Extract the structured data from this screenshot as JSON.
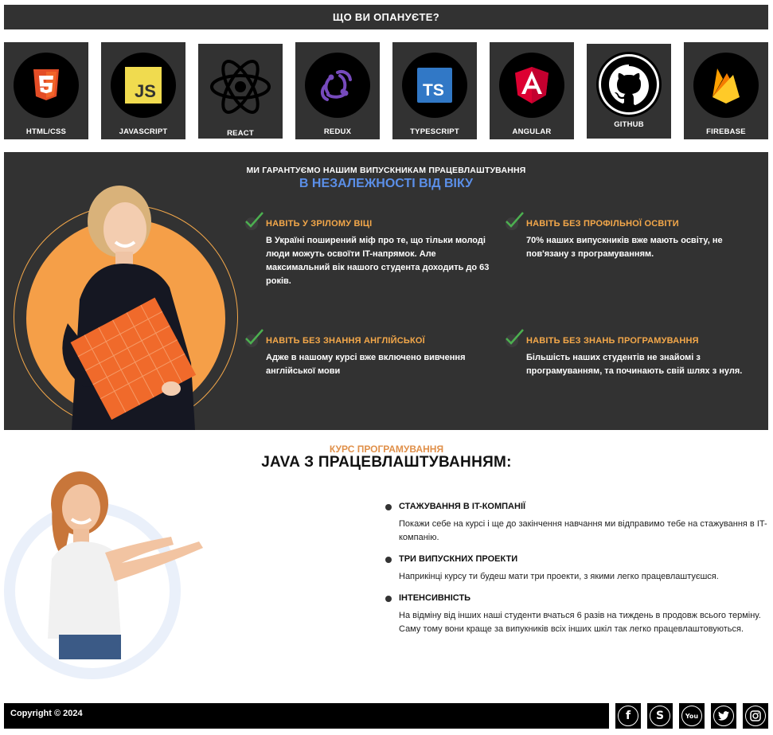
{
  "header": {
    "title": "ЩО ВИ ОПАНУЄТЕ?"
  },
  "technologies": [
    {
      "label": "HTML/CSS",
      "icon": "html5-icon"
    },
    {
      "label": "JAVASCRIPT",
      "icon": "javascript-icon"
    },
    {
      "label": "REACT",
      "icon": "react-icon"
    },
    {
      "label": "REDUX",
      "icon": "redux-icon"
    },
    {
      "label": "TYPESCRIPT",
      "icon": "typescript-icon"
    },
    {
      "label": "ANGULAR",
      "icon": "angular-icon"
    },
    {
      "label": "GITHUB",
      "icon": "github-icon"
    },
    {
      "label": "FIREBASE",
      "icon": "firebase-icon"
    }
  ],
  "guarantee": {
    "title": "МИ ГАРАНТУЄМО НАШИМ ВИПУСКНИКАМ ПРАЦЕВЛАШТУВАННЯ",
    "accent": "В НЕЗАЛЕЖНОСТІ ВІД ВІКУ",
    "features": [
      {
        "title": "НАВІТЬ У ЗРІЛОМУ ВІЦІ",
        "text": "В Україні поширений міф про те, що тільки молоді люди можуть освоїти IT-напрямок. Але максимальний вік нашого студента доходить до 63 років."
      },
      {
        "title": "НАВІТЬ БЕЗ ПРОФІЛЬНОЇ ОСВІТИ",
        "text": "70% наших випускників вже мають освіту, не пов'язану з програмуванням."
      },
      {
        "title": "НАВІТЬ БЕЗ ЗНАННЯ АНГЛІЙСЬКОЇ",
        "text": "Адже в нашому курсі вже включено вивчення англійської мови"
      },
      {
        "title": "НАВІТЬ БЕЗ ЗНАНЬ ПРОГРАМУВАННЯ",
        "text": "Більшість наших студентів не знайомі з програмуванням, та починають свій шлях з нуля."
      }
    ]
  },
  "course": {
    "subtitle": "КУРС ПРОГРАМУВАННЯ",
    "title": "JAVA З ПРАЦЕВЛАШТУВАННЯМ:",
    "items": [
      {
        "title": "СТАЖУВАННЯ В IT-КОМПАНІЇ",
        "text": "Покажи себе на курсі і ще до закінчення навчання ми відправимо тебе на стажування в IT-компанію."
      },
      {
        "title": "ТРИ ВИПУСКНИХ ПРОЕКТИ",
        "text": "Наприкінці курсу ти будеш мати три проекти, з якими легко працевлаштуєшся."
      },
      {
        "title": "ІНТЕНСИВНІСТЬ",
        "text": "На відміну від інших наші студенти вчаться 6 разів на тиждень в продовж всього терміну. Саму тому вони краще за випукників всіх інших шкіл так легко працевлаштовуються."
      }
    ]
  },
  "footer": {
    "copyright": "Copyright © 2024",
    "social": [
      {
        "icon": "facebook-icon",
        "glyph": "f"
      },
      {
        "icon": "skype-icon",
        "glyph": "S"
      },
      {
        "icon": "youtube-icon",
        "glyph": "You"
      },
      {
        "icon": "twitter-icon",
        "glyph": ""
      },
      {
        "icon": "instagram-icon",
        "glyph": ""
      }
    ]
  },
  "colors": {
    "dark_panel": "#323232",
    "accent_orange": "#f4a84a",
    "accent_blue": "#5b8fe8",
    "check_green": "#4caf50"
  }
}
